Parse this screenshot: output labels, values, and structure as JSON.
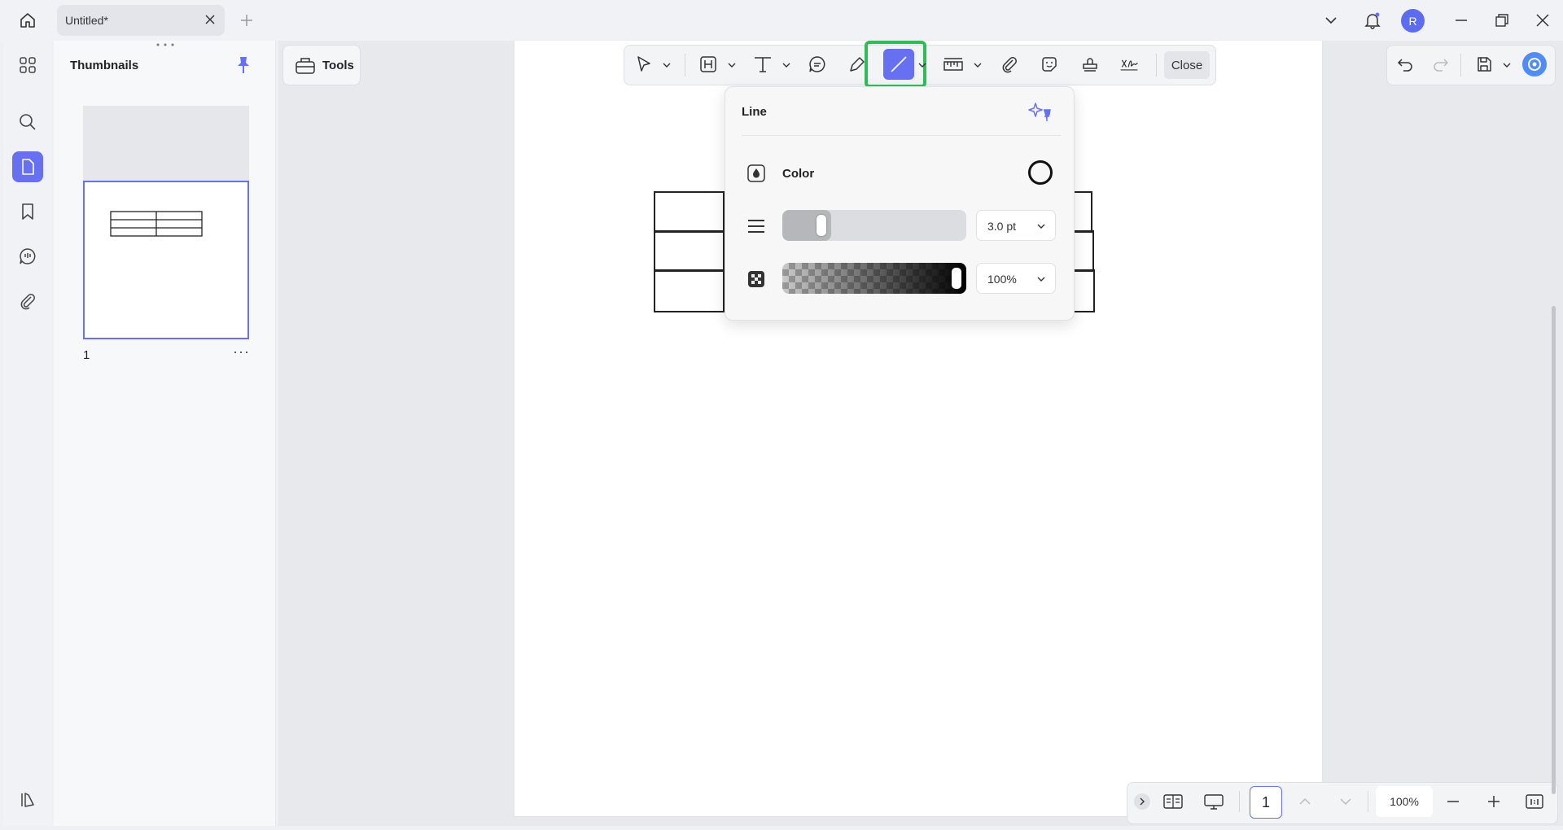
{
  "titlebar": {
    "tab_title": "Untitled*",
    "avatar_initial": "R"
  },
  "thumbnails": {
    "title": "Thumbnails",
    "page_number": "1",
    "more_label": "···"
  },
  "tools": {
    "label": "Tools"
  },
  "annotation_toolbar": {
    "close_label": "Close",
    "active_tool": "line-icon"
  },
  "line_popup": {
    "title": "Line",
    "color_label": "Color",
    "thickness_value": "3.0 pt",
    "thickness_level": 0.18,
    "opacity_value": "100%",
    "opacity_level": 1.0
  },
  "bottombar": {
    "page_input": "1",
    "zoom": "100%"
  },
  "colors": {
    "accent": "#6670f0",
    "highlight": "#2fbe56"
  }
}
